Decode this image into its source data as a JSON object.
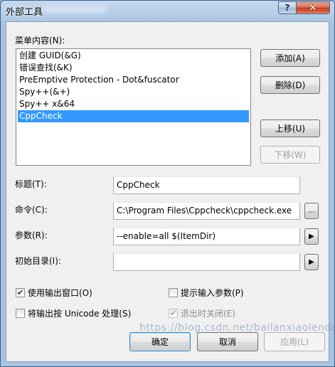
{
  "window": {
    "title": "外部工具"
  },
  "titlebar": {
    "help_glyph": "?",
    "close_glyph": "✕"
  },
  "menu": {
    "label": "菜单内容(N):",
    "items": [
      "创建 GUID(&G)",
      "错误查找(&K)",
      "PreEmptive Protection - Dot&fuscator",
      "Spy++(&+)",
      "Spy++ x&64",
      "CppCheck"
    ],
    "selected_index": 5
  },
  "side_buttons": {
    "add": "添加(A)",
    "delete": "删除(D)",
    "move_up": "上移(U)",
    "move_down": "下移(W)"
  },
  "fields": {
    "title_label": "标题(T):",
    "title_value": "CppCheck",
    "command_label": "命令(C):",
    "command_value": "C:\\Program Files\\Cppcheck\\cppcheck.exe",
    "browse_label": "...",
    "args_label": "参数(R):",
    "args_value": "--enable=all $(ItemDir)",
    "initdir_label": "初始目录(I):",
    "initdir_value": "",
    "arrow_glyph": "▶"
  },
  "options": {
    "use_output_window": {
      "label": "使用输出窗口(O)",
      "checked": true
    },
    "prompt_arguments": {
      "label": "提示输入参数(P)",
      "checked": false
    },
    "treat_unicode": {
      "label": "将输出按 Unicode 处理(S)",
      "checked": false
    },
    "close_on_exit": {
      "label": "退出时关闭(E)",
      "checked": true,
      "disabled": true
    },
    "check_glyph": "✔"
  },
  "footer": {
    "ok": "确定",
    "cancel": "取消",
    "apply": "应用(L)"
  },
  "watermark": "https://blog.csdn.net/bailanxiaolendu"
}
